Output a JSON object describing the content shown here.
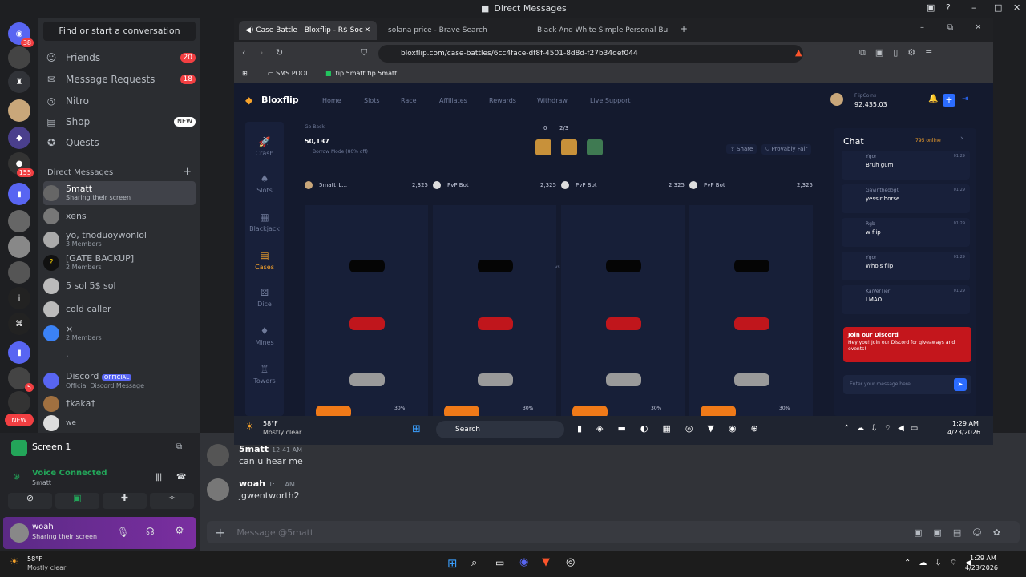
{
  "window_title": "Direct Messages",
  "servers": {
    "badges": [
      "38",
      "155",
      "5",
      "NEW"
    ]
  },
  "dm": {
    "search": "Find or start a conversation",
    "nav": [
      {
        "label": "Friends",
        "count": "20"
      },
      {
        "label": "Message Requests",
        "count": "18"
      },
      {
        "label": "Nitro",
        "count": ""
      },
      {
        "label": "Shop",
        "badge": "NEW"
      },
      {
        "label": "Quests",
        "count": ""
      }
    ],
    "header": "Direct Messages",
    "items": [
      {
        "name": "5matt",
        "sub": "Sharing their screen"
      },
      {
        "name": "xens",
        "sub": ""
      },
      {
        "name": "yo, tnoduoywonlol",
        "sub": "3 Members"
      },
      {
        "name": "[GATE BACKUP]",
        "sub": "2 Members"
      },
      {
        "name": "5 sol 5$ sol",
        "sub": ""
      },
      {
        "name": "cold caller",
        "sub": ""
      },
      {
        "name": "×",
        "sub": "2 Members"
      },
      {
        "name": ".",
        "sub": ""
      },
      {
        "name": "Discord",
        "tag": "OFFICIAL",
        "sub": "Official Discord Message"
      },
      {
        "name": "†kaka†",
        "sub": ""
      },
      {
        "name": "we",
        "sub": ""
      }
    ]
  },
  "screenshare": {
    "title": "Screen 1",
    "voice": "Voice Connected",
    "voice_sub": "5matt"
  },
  "user": {
    "name": "woah",
    "status": "Sharing their screen"
  },
  "messages": [
    {
      "author": "5matt",
      "time": "12:41 AM",
      "text": "can u hear me"
    },
    {
      "author": "woah",
      "time": "1:11 AM",
      "text": "jgwentworth2"
    }
  ],
  "input_placeholder": "Message @5matt",
  "taskbar": {
    "temp": "58°F",
    "weather": "Mostly clear",
    "time": "1:29 AM",
    "date": "4/23/2026"
  },
  "browser": {
    "tabs": [
      "Case Battle | Bloxflip - R$ Soc",
      "solana price - Brave Search",
      "Black And White Simple Personal Bu"
    ],
    "url": "bloxflip.com/case-battles/6cc4face-df8f-4501-8d8d-f27b34def044",
    "bookmarks": [
      "SMS POOL",
      ".tip 5matt.tip 5matt..."
    ]
  },
  "site": {
    "logo": "Bloxflip",
    "nav": [
      "Home",
      "Slots",
      "Race",
      "Affiliates",
      "Rewards",
      "Withdraw",
      "Live Support"
    ],
    "balance_label": "FlipCoins",
    "balance": "92,435.03",
    "left": [
      "Crash",
      "Slots",
      "Blackjack",
      "Cases",
      "Dice",
      "Mines",
      "Towers"
    ],
    "back": "Go Back",
    "battle_value": "50,137",
    "borrow": "Borrow Mode (80% off)",
    "round": "2/3",
    "count": "0",
    "share": "Share",
    "fair": "Provably Fair",
    "players": [
      {
        "name": "5matt_L...",
        "value": "2,325"
      },
      {
        "name": "PvP Bot",
        "value": "2,325"
      },
      {
        "name": "PvP Bot",
        "value": "2,325"
      },
      {
        "name": "PvP Bot",
        "value": "2,325"
      }
    ],
    "vs": "vs",
    "pct": "30%",
    "chat_title": "Chat",
    "online": "795 online",
    "chat": [
      {
        "user": "Ygor",
        "msg": "Bruh gum",
        "time": "01:29"
      },
      {
        "user": "Gavinthedog0",
        "msg": "yessir horse",
        "time": "01:29"
      },
      {
        "user": "Rgb",
        "msg": "w flip",
        "time": "01:29"
      },
      {
        "user": "Ygor",
        "msg": "Who's flip",
        "time": "01:29"
      },
      {
        "user": "KaiVerTier",
        "msg": "LMAO",
        "time": "01:29"
      }
    ],
    "promo_title": "Join our Discord",
    "promo_text": "Hey you! Join our Discord for giveaways and events!",
    "chat_input": "Enter your message here..."
  },
  "win_taskbar": {
    "temp": "58°F",
    "weather": "Mostly clear",
    "search": "Search",
    "time": "1:29 AM",
    "date": "4/23/2026"
  }
}
